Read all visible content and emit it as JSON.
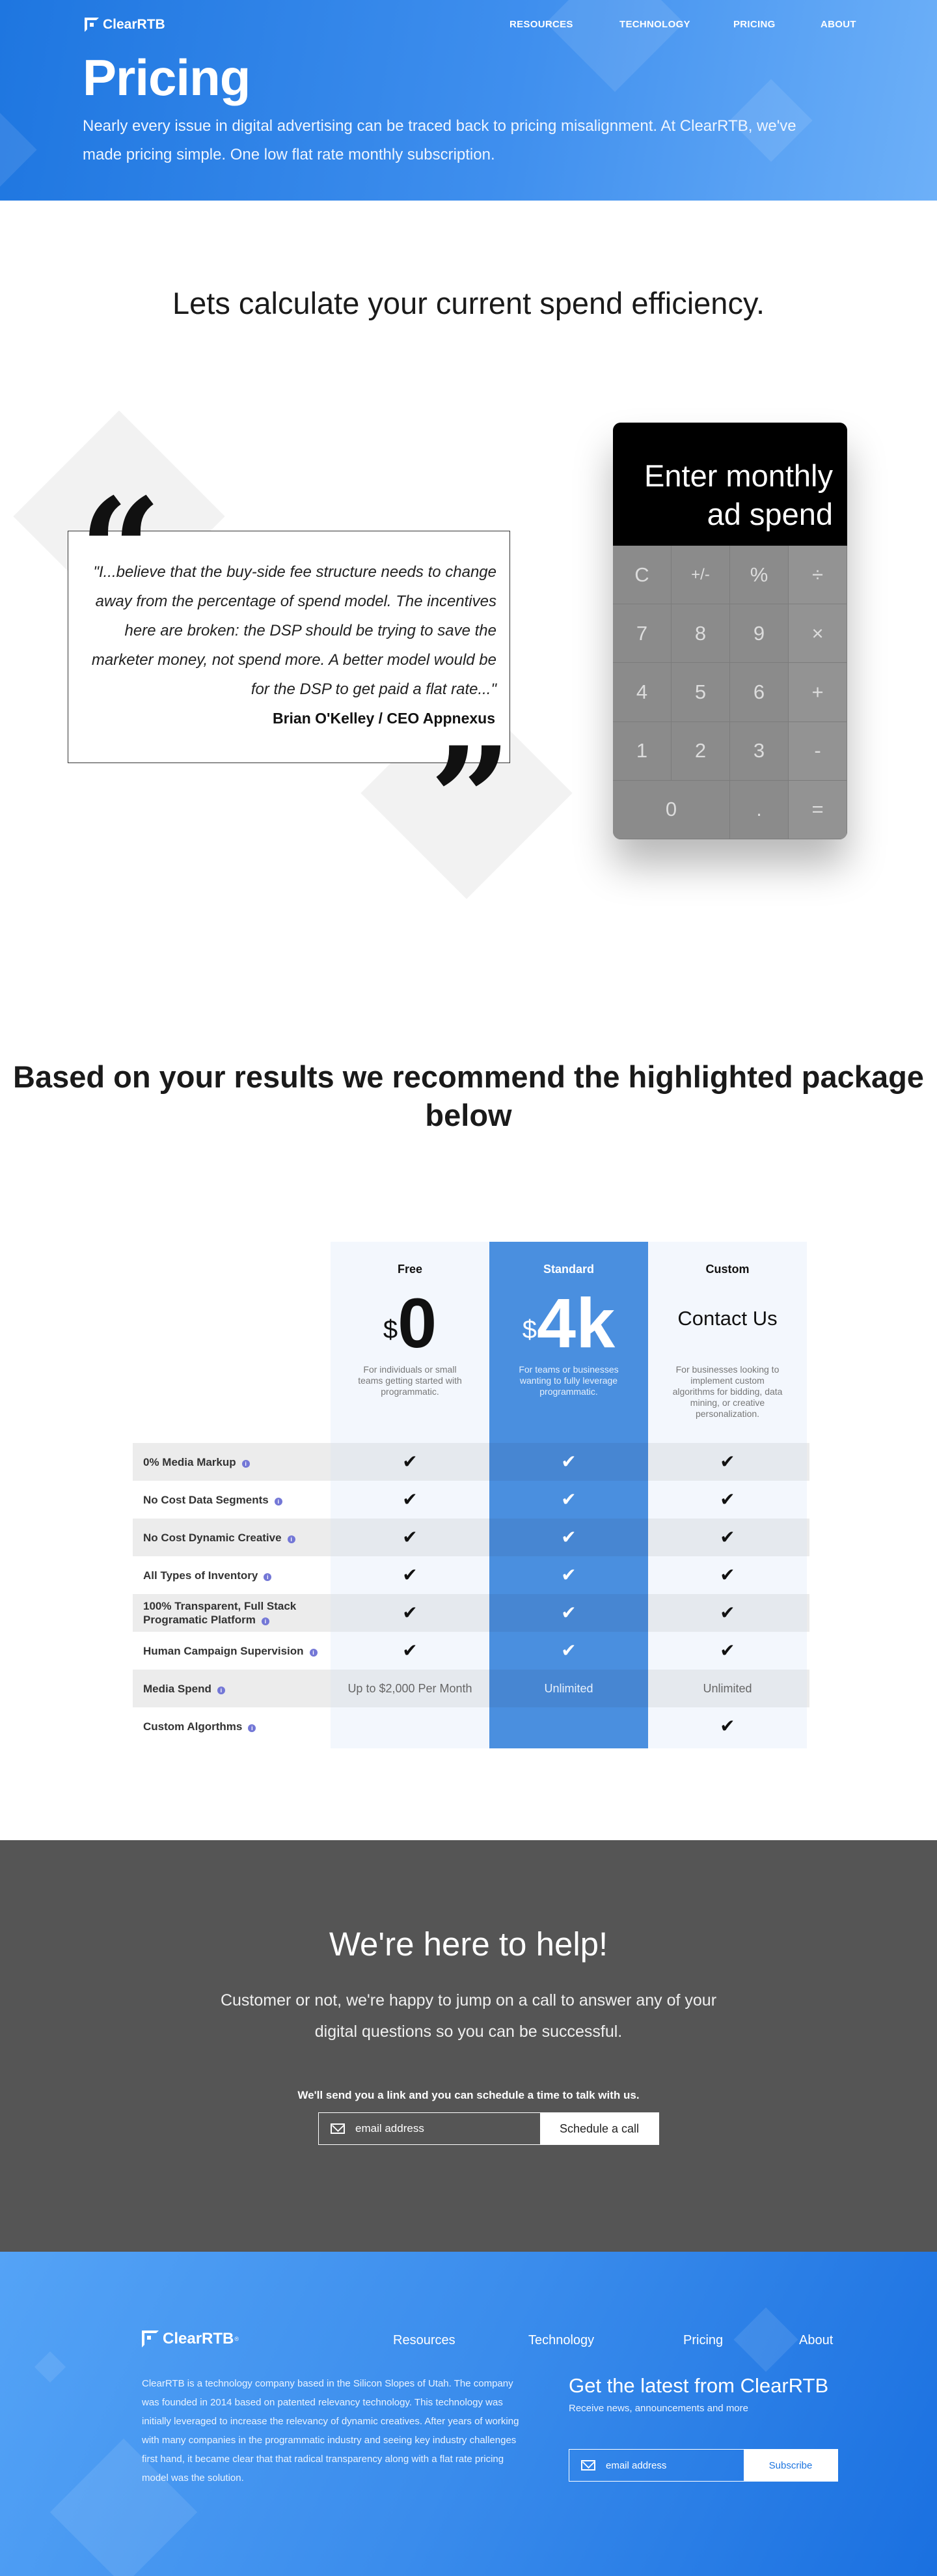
{
  "brand": {
    "name": "ClearRTB",
    "mark": "®"
  },
  "nav": {
    "resources": "RESOURCES",
    "technology": "TECHNOLOGY",
    "pricing": "PRICING",
    "about": "ABOUT"
  },
  "hero": {
    "title": "Pricing",
    "description": "Nearly every issue in digital advertising can be traced back to pricing misalignment. At ClearRTB, we've made pricing simple. One low flat rate monthly subscription."
  },
  "calc_section": {
    "heading": "Lets calculate your current spend efficiency.",
    "quote": {
      "text": "\"I...believe that the buy-side fee structure needs to change away from the percentage of spend model. The incentives here are broken: the DSP should be trying to save the marketer money, not spend more. A better model would be for the DSP to get paid a flat rate...\"",
      "author": "Brian O'Kelley / CEO Appnexus",
      "open_mark": "“",
      "close_mark": "”"
    },
    "calculator": {
      "display": "Enter monthly ad spend",
      "keys": [
        "C",
        "+/-",
        "%",
        "÷",
        "7",
        "8",
        "9",
        "×",
        "4",
        "5",
        "6",
        "+",
        "1",
        "2",
        "3",
        "-",
        "0",
        ".",
        "="
      ]
    }
  },
  "recommend": {
    "heading": "Based on your results we recommend the highlighted package below",
    "plans": [
      {
        "name": "Free",
        "currency": "$",
        "price": "0",
        "desc": "For individuals or small teams getting started with programmatic."
      },
      {
        "name": "Standard",
        "currency": "$",
        "price": "4k",
        "desc": "For teams or businesses wanting to fully leverage programmatic."
      },
      {
        "name": "Custom",
        "contact": "Contact Us",
        "desc": "For businesses looking to implement custom algorithms for bidding, data mining, or creative personalization."
      }
    ],
    "info_icon": "i",
    "check_icon": "✔",
    "features": [
      {
        "label": "0% Media Markup",
        "cells": [
          "✔",
          "✔",
          "✔"
        ]
      },
      {
        "label": "No Cost Data Segments",
        "cells": [
          "✔",
          "✔",
          "✔"
        ]
      },
      {
        "label": "No Cost Dynamic Creative",
        "cells": [
          "✔",
          "✔",
          "✔"
        ]
      },
      {
        "label": "All Types of Inventory",
        "cells": [
          "✔",
          "✔",
          "✔"
        ]
      },
      {
        "label": "100% Transparent, Full Stack Programatic Platform",
        "cells": [
          "✔",
          "✔",
          "✔"
        ]
      },
      {
        "label": "Human Campaign Supervision",
        "cells": [
          "✔",
          "✔",
          "✔"
        ]
      },
      {
        "label": "Media Spend",
        "cells": [
          "Up to $2,000 Per Month",
          "Unlimited",
          "Unlimited"
        ]
      },
      {
        "label": "Custom Algorthms",
        "cells": [
          "",
          "",
          "✔"
        ]
      }
    ]
  },
  "help": {
    "title": "We're here to help!",
    "description": "Customer or not, we're happy to jump on a call to answer any of your digital questions so you can be successful.",
    "small": "We'll send you a link and you can schedule a time to talk with us.",
    "email_placeholder": "email address",
    "button": "Schedule a call"
  },
  "footer": {
    "nav": {
      "resources": "Resources",
      "technology": "Technology",
      "pricing": "Pricing",
      "about": "About"
    },
    "about": "ClearRTB is a technology company based in the Silicon Slopes of Utah.  The company was founded in 2014 based on patented relevancy technology.  This technology was initially leveraged to increase the relevancy of dynamic creatives.  After years of working with many companies in the programmatic industry and seeing key industry challenges first hand, it became clear that that radical transparency along with a flat rate pricing model was the solution.",
    "news_title": "Get the latest from ClearRTB",
    "news_sub": "Receive news, announcements and more",
    "email_placeholder": "email address",
    "subscribe": "Subscribe"
  },
  "colors": {
    "brand_blue": "#1e76e0",
    "highlight_blue": "#4a8fdf",
    "panel_light": "#f3f7fd",
    "dark_gray": "#555555"
  }
}
